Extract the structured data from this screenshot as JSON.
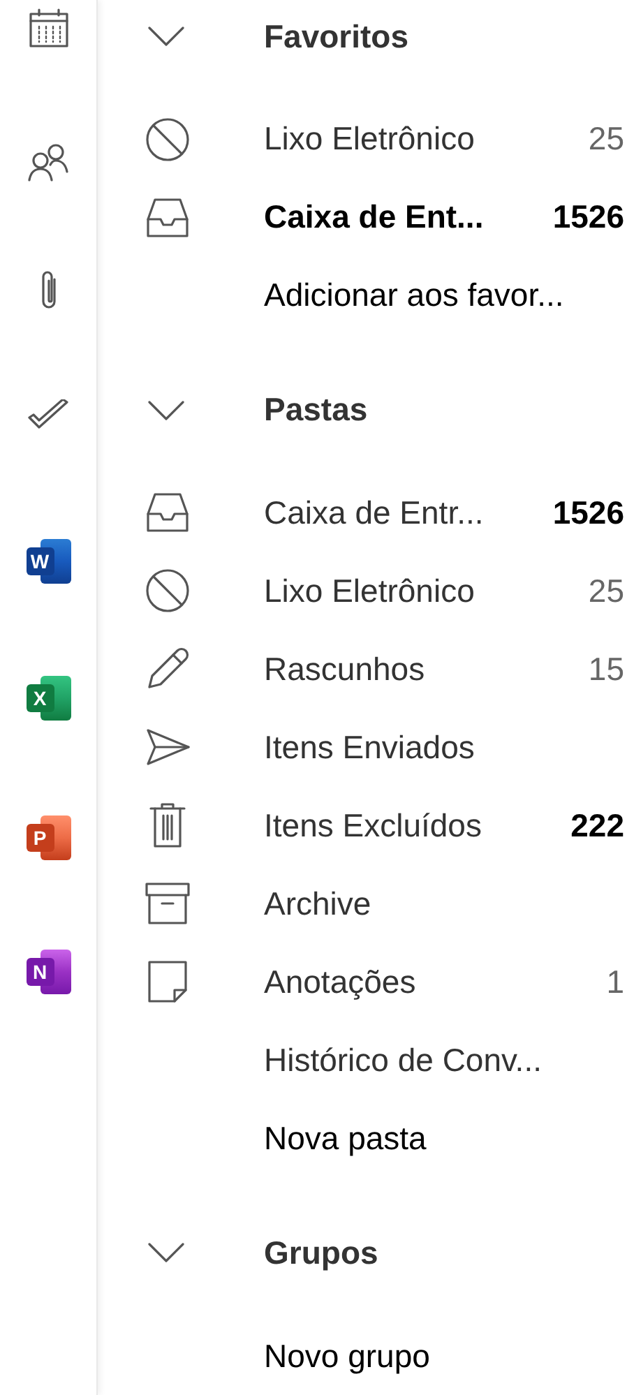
{
  "rail": [
    {
      "kind": "calendar"
    },
    {
      "kind": "people"
    },
    {
      "kind": "attachment"
    },
    {
      "kind": "todo"
    },
    {
      "kind": "word",
      "letter": "W"
    },
    {
      "kind": "excel",
      "letter": "X"
    },
    {
      "kind": "powerpoint",
      "letter": "P"
    },
    {
      "kind": "onenote",
      "letter": "N"
    }
  ],
  "sections": [
    {
      "title": "Favoritos",
      "expanded": true,
      "items": [
        {
          "kind": "junk",
          "label": "Lixo Eletrônico",
          "count": "25",
          "highlighted": false,
          "unread": false
        },
        {
          "kind": "inbox",
          "label": "Caixa de Ent...",
          "count": "1526",
          "highlighted": true,
          "unread": true
        },
        {
          "kind": "action",
          "label": "Adicionar aos favor...",
          "highlighted": false
        }
      ]
    },
    {
      "title": "Pastas",
      "expanded": true,
      "items": [
        {
          "kind": "inbox",
          "label": "Caixa de Entr...",
          "count": "1526",
          "highlighted": false,
          "unread": true
        },
        {
          "kind": "junk",
          "label": "Lixo Eletrônico",
          "count": "25",
          "highlighted": false,
          "unread": false
        },
        {
          "kind": "drafts",
          "label": "Rascunhos",
          "count": "15",
          "highlighted": false,
          "unread": false
        },
        {
          "kind": "sent",
          "label": "Itens Enviados",
          "highlighted": false
        },
        {
          "kind": "deleted",
          "label": "Itens Excluídos",
          "count": "222",
          "highlighted": false,
          "unread": true
        },
        {
          "kind": "archive",
          "label": "Archive",
          "highlighted": false
        },
        {
          "kind": "notes",
          "label": "Anotações",
          "count": "1",
          "highlighted": false,
          "unread": false
        },
        {
          "kind": "folder",
          "label": "Histórico de Conv...",
          "highlighted": false
        },
        {
          "kind": "action",
          "label": "Nova pasta",
          "highlighted": false
        }
      ]
    },
    {
      "title": "Grupos",
      "expanded": true,
      "items": [
        {
          "kind": "action",
          "label": "Novo grupo",
          "highlighted": false
        }
      ]
    }
  ]
}
